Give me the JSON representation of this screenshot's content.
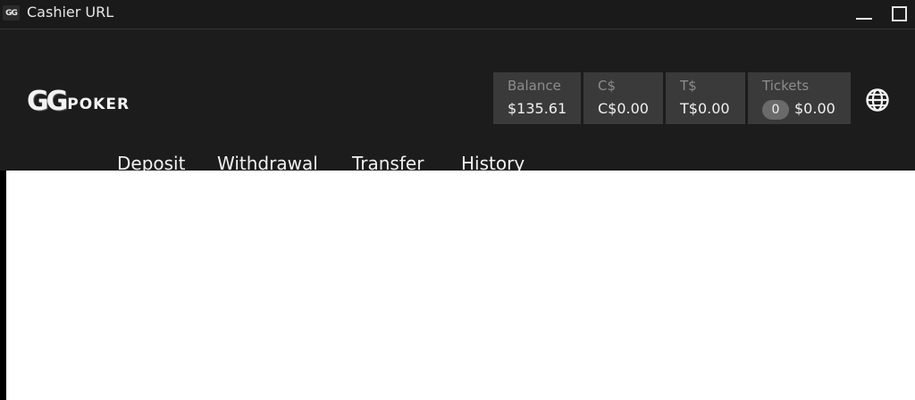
{
  "window": {
    "icon_text": "GG",
    "title": "Cashier URL"
  },
  "brand": {
    "gg": "GG",
    "poker": "POKER"
  },
  "balances": {
    "balance": {
      "label": "Balance",
      "value": "$135.61"
    },
    "c_dollars": {
      "label": "C$",
      "value": "C$0.00"
    },
    "t_dollars": {
      "label": "T$",
      "value": "T$0.00"
    },
    "tickets": {
      "label": "Tickets",
      "count": "0",
      "value": "$0.00"
    }
  },
  "nav": {
    "deposit": "Deposit",
    "withdrawal": "Withdrawal",
    "transfer": "Transfer",
    "history": "History"
  },
  "icons": {
    "language": "globe-icon",
    "minimize": "minimize-icon",
    "maximize": "maximize-icon"
  },
  "colors": {
    "header_bg": "#1c1c1c",
    "stat_bg": "#3a3a3a",
    "content_bg": "#ffffff"
  }
}
